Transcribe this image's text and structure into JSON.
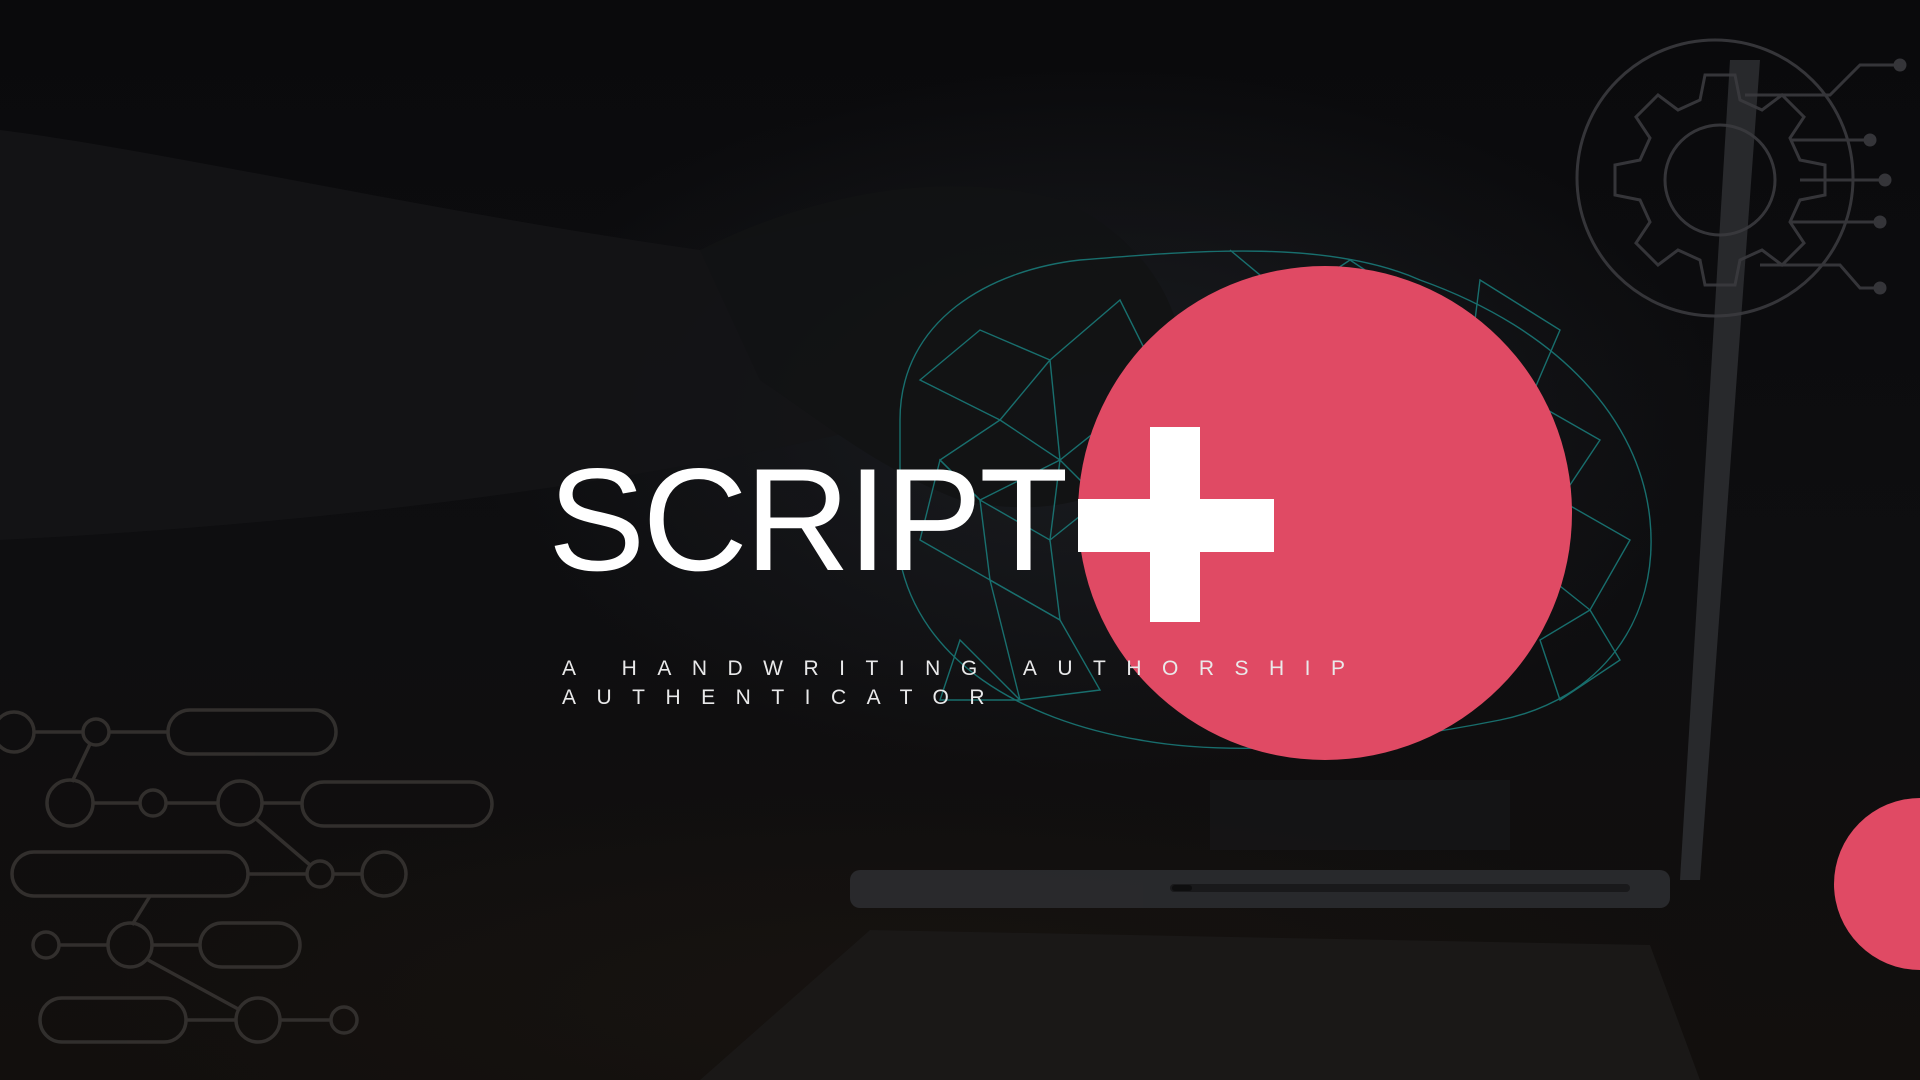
{
  "slide": {
    "title": "SCRIPT",
    "subtitle_line1": "A HANDWRITING AUTHORSHIP",
    "subtitle_line2": "AUTHENTICATOR"
  },
  "colors": {
    "accent": "#e04a64",
    "text": "#ffffff",
    "background": "#0b0b0d",
    "mesh": "#1fa3a0"
  },
  "icons": [
    "gear-circuit-icon",
    "plus-icon",
    "circuit-network-decoration"
  ]
}
